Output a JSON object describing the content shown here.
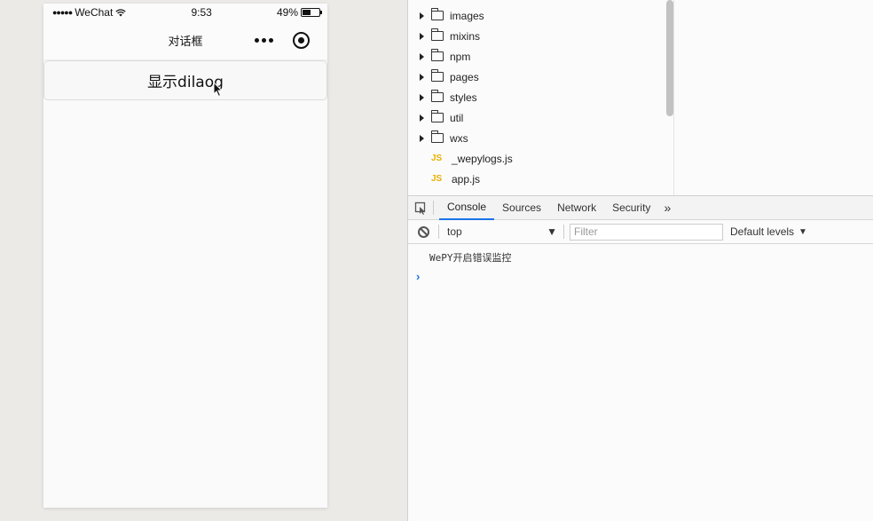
{
  "phone": {
    "status": {
      "carrier": "WeChat",
      "time": "9:53",
      "battery": "49%",
      "battery_level": 0.49
    },
    "nav": {
      "title": "对话框"
    },
    "button_label": "显示dilaog"
  },
  "devtools": {
    "tree": [
      {
        "type": "folder",
        "name": "images"
      },
      {
        "type": "folder",
        "name": "mixins"
      },
      {
        "type": "folder",
        "name": "npm"
      },
      {
        "type": "folder",
        "name": "pages"
      },
      {
        "type": "folder",
        "name": "styles"
      },
      {
        "type": "folder",
        "name": "util"
      },
      {
        "type": "folder",
        "name": "wxs"
      },
      {
        "type": "file",
        "name": "_wepylogs.js",
        "icon": "JS"
      },
      {
        "type": "file",
        "name": "app.js",
        "icon": "JS"
      }
    ],
    "tabs": [
      "Console",
      "Sources",
      "Network",
      "Security"
    ],
    "active_tab": "Console",
    "context": "top",
    "filter_placeholder": "Filter",
    "levels": "Default levels",
    "console_lines": [
      "WePY开启错误监控"
    ]
  },
  "colors": {
    "accent": "#1a73e8",
    "js_icon": "#e8b100"
  }
}
